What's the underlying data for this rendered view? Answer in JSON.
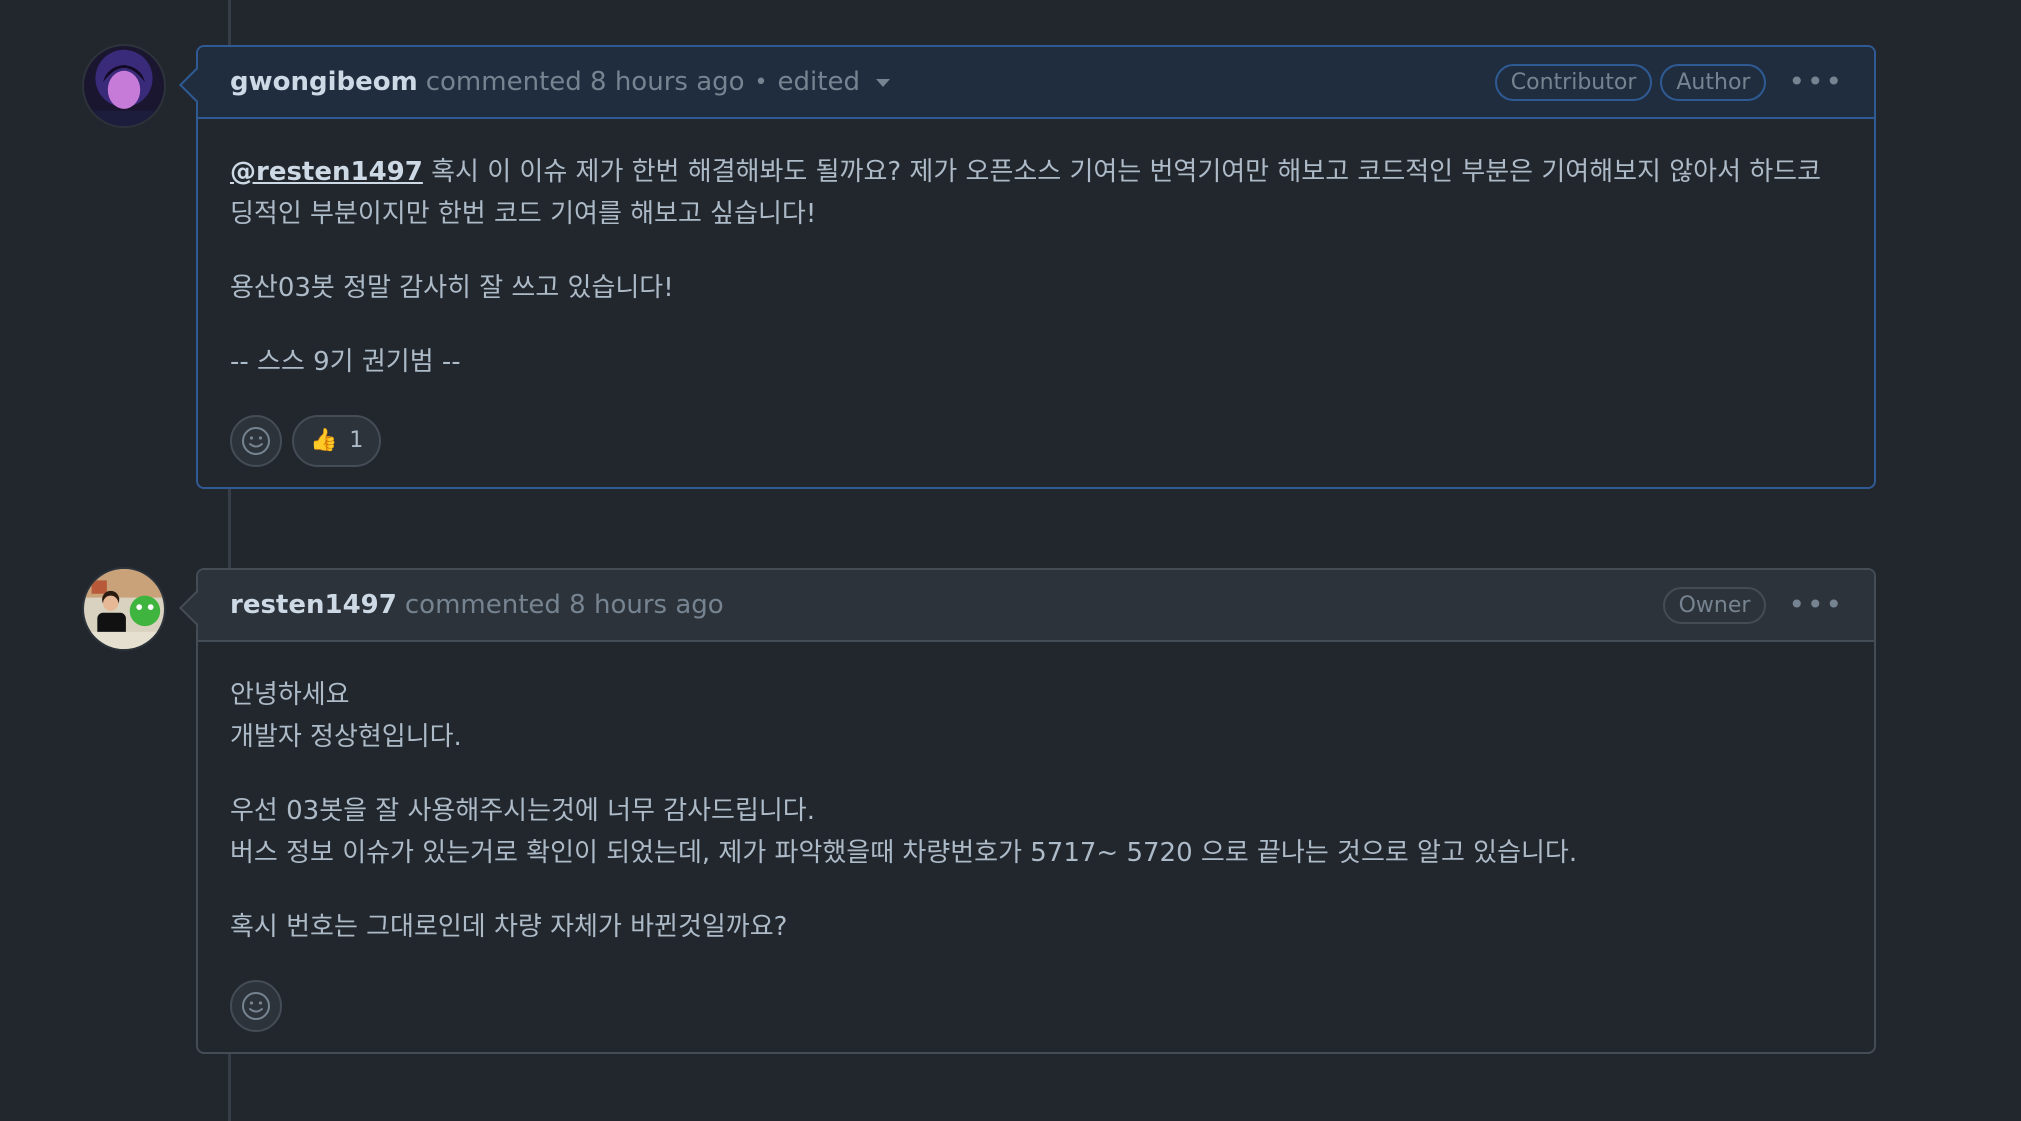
{
  "comments": [
    {
      "username": "gwongibeom",
      "action": "commented 8 hours ago",
      "edited": "edited",
      "labels": [
        "Contributor",
        "Author"
      ],
      "mention": "@resten1497",
      "paragraphs": [
        " 혹시 이 이슈 제가 한번 해결해봐도 될까요? 제가 오픈소스 기여는 번역기여만 해보고 코드적인 부분은 기여해보지 않아서 하드코딩적인 부분이지만 한번 코드 기여를 해보고 싶습니다!",
        "용산03봇 정말 감사히 잘 쓰고 있습니다!",
        "-- 스스 9기 권기범 --"
      ],
      "reaction": {
        "emoji": "👍",
        "count": "1"
      }
    },
    {
      "username": "resten1497",
      "action": "commented 8 hours ago",
      "labels": [
        "Owner"
      ],
      "paragraphs": [
        [
          "안녕하세요",
          "개발자 정상현입니다."
        ],
        [
          "우선 03봇을 잘 사용해주시는것에 너무 감사드립니다.",
          "버스 정보 이슈가 있는거로 확인이 되었는데, 제가 파악했을때 차량번호가 5717~ 5720 으로 끝나는 것으로 알고 있습니다."
        ],
        [
          "혹시 번호는 그대로인데 차량 자체가 바뀐것일까요?"
        ]
      ]
    }
  ],
  "icons": {
    "more": "kebab-horizontal-icon",
    "smiley": "smiley-icon",
    "caret": "triangle-down-icon"
  }
}
